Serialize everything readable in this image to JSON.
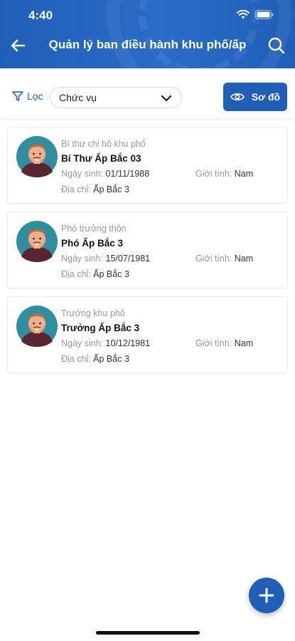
{
  "status_bar": {
    "time": "4:40"
  },
  "header": {
    "title": "Quản lý ban điều hành khu phố/ấp"
  },
  "filter": {
    "filter_label": "Lọc",
    "select_value": "Chức vụ",
    "diagram_label": "Sơ đồ"
  },
  "labels": {
    "dob": "Ngày sinh:",
    "gender": "Giới tính:",
    "address": "Địa chỉ:"
  },
  "members": [
    {
      "role": "Bí thư chi bộ khu phố",
      "name": "Bí Thư Ấp Bắc 03",
      "dob": "01/11/1988",
      "gender": "Nam",
      "address": "Ấp Bắc 3"
    },
    {
      "role": "Phó trưởng thôn",
      "name": "Phó Ấp Bắc 3",
      "dob": "15/07/1981",
      "gender": "Nam",
      "address": "Ấp Bắc 3"
    },
    {
      "role": "Trưởng khu phố",
      "name": "Trưởng Ấp Bắc 3",
      "dob": "10/12/1981",
      "gender": "Nam",
      "address": "Ấp Bắc 3"
    }
  ],
  "colors": {
    "primary": "#1f5fb8",
    "muted": "#9a9a9a"
  }
}
